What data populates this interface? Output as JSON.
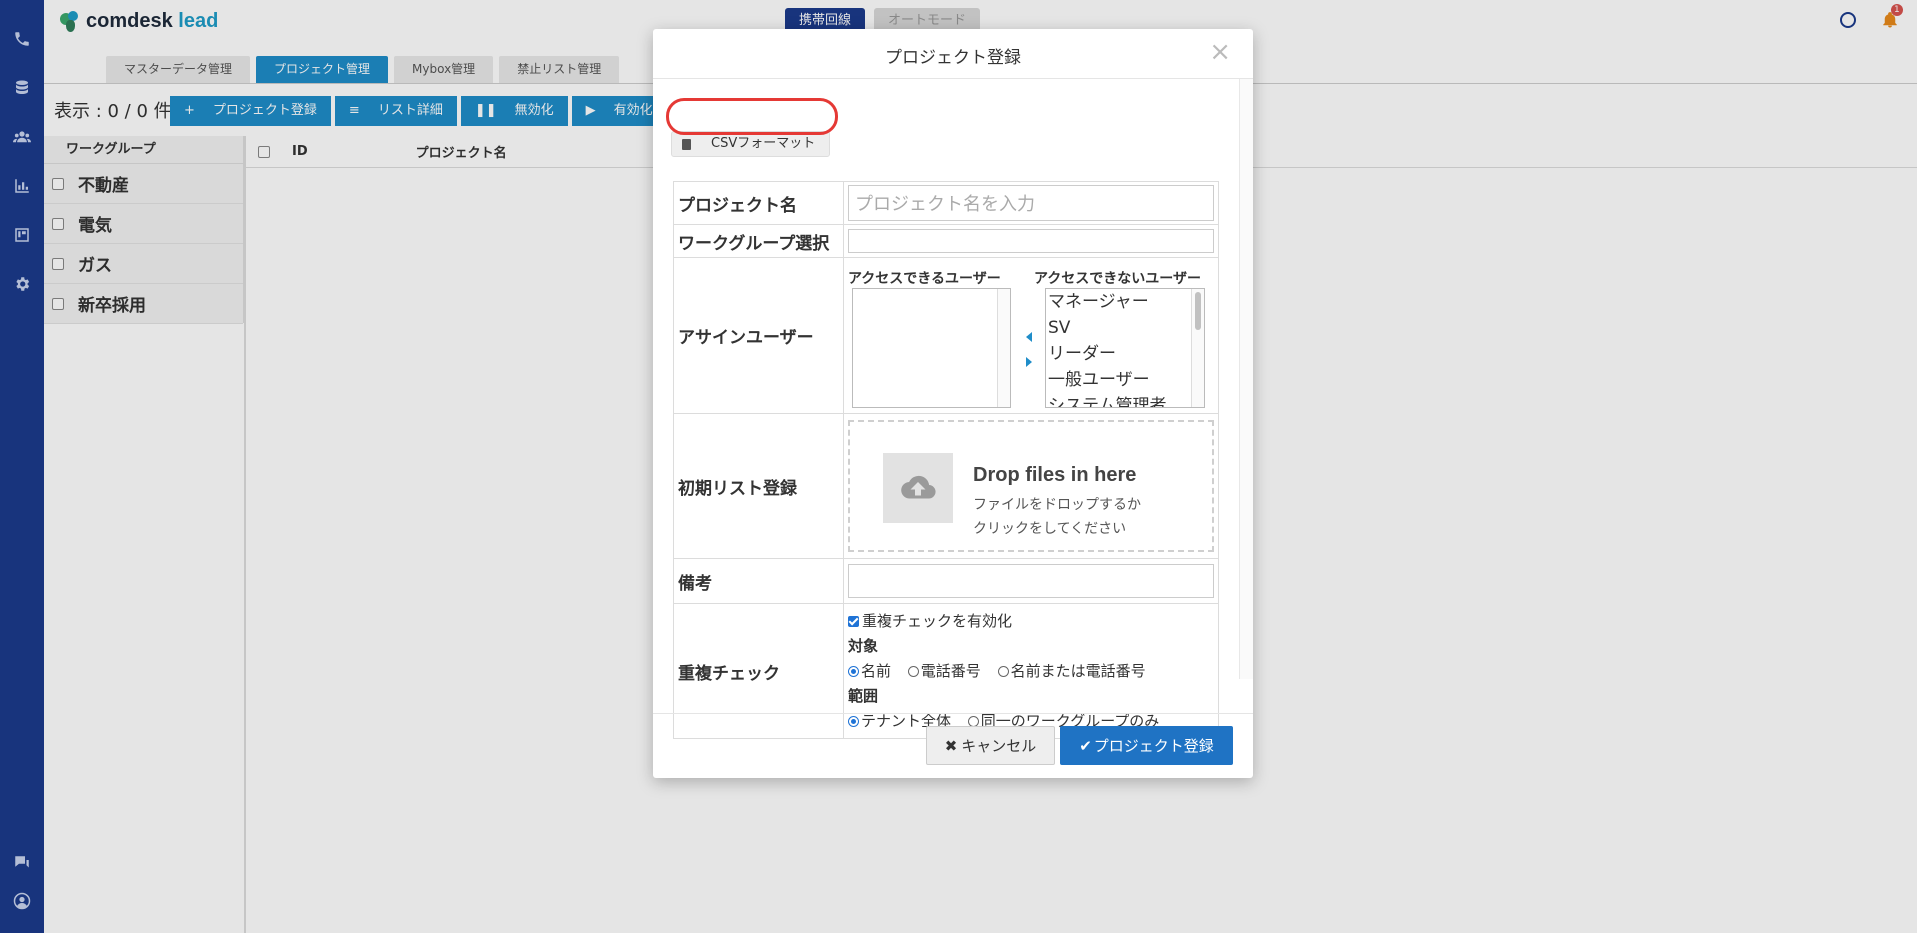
{
  "app": {
    "logo_main": "comdesk",
    "logo_accent": "lead",
    "mode_buttons": [
      "携帯回線",
      "オートモード"
    ],
    "tabs": [
      "マスターデータ管理",
      "プロジェクト管理",
      "Mybox管理",
      "禁止リスト管理"
    ],
    "count_text": "表示 : 0 / 0 件",
    "toolbar": [
      "プロジェクト登録",
      "リスト詳細",
      "無効化",
      "有効化"
    ],
    "sidebar_header": "ワークグループ",
    "groups": [
      "不動産",
      "電気",
      "ガス",
      "新卒採用"
    ],
    "table_headers": [
      "ID",
      "プロジェクト名"
    ],
    "notification_count": "1"
  },
  "modal": {
    "title": "プロジェクト登録",
    "close": "×",
    "csv_button": "CSVフォーマット",
    "project_name_label": "プロジェクト名",
    "project_name_placeholder": "プロジェクト名を入力",
    "workgroup_label": "ワークグループ選択",
    "assign_label": "アサインユーザー",
    "access_users_title": "アクセスできるユーザー",
    "no_access_users_title": "アクセスできないユーザー",
    "no_access_users": [
      "マネージャー",
      "SV",
      "リーダー",
      "一般ユーザー",
      "システム管理者"
    ],
    "initial_list_label": "初期リスト登録",
    "drop_title": "Drop files in here",
    "drop_line1": "ファイルをドロップするか",
    "drop_line2": "クリックをしてください",
    "notes_label": "備考",
    "dup_label": "重複チェック",
    "dup_enable": "重複チェックを有効化",
    "target_label": "対象",
    "target_options": [
      "名前",
      "電話番号",
      "名前または電話番号"
    ],
    "scope_label": "範囲",
    "scope_options": [
      "テナント全体",
      "同一のワークグループのみ"
    ],
    "cancel_button": "キャンセル",
    "submit_button": "プロジェクト登録"
  },
  "colors": {
    "rail": "#1b3a8c",
    "primary": "#1f8dc9",
    "submit": "#1f73c4",
    "highlight": "#e53935"
  }
}
